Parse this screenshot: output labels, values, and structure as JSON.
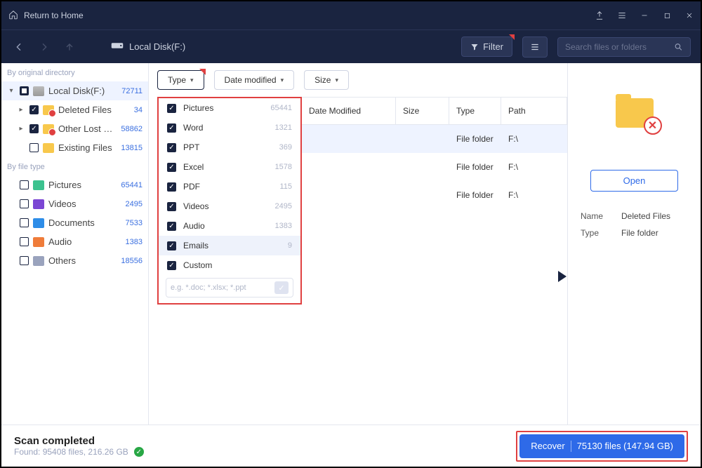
{
  "titlebar": {
    "return": "Return to Home"
  },
  "toolbar": {
    "location": "Local Disk(F:)",
    "filter_label": "Filter",
    "search_placeholder": "Search files or folders"
  },
  "filters": {
    "type": "Type",
    "date": "Date modified",
    "size": "Size"
  },
  "type_panel": {
    "items": [
      {
        "label": "Pictures",
        "count": "65441"
      },
      {
        "label": "Word",
        "count": "1321"
      },
      {
        "label": "PPT",
        "count": "369"
      },
      {
        "label": "Excel",
        "count": "1578"
      },
      {
        "label": "PDF",
        "count": "115"
      },
      {
        "label": "Videos",
        "count": "2495"
      },
      {
        "label": "Audio",
        "count": "1383"
      },
      {
        "label": "Emails",
        "count": "9"
      },
      {
        "label": "Custom",
        "count": ""
      }
    ],
    "input_placeholder": "e.g. *.doc; *.xlsx; *.ppt"
  },
  "sidebar": {
    "head1": "By original directory",
    "head2": "By file type",
    "dir": [
      {
        "label": "Local Disk(F:)",
        "count": "72711",
        "icon": "ic-disk",
        "state": "mixed",
        "arrow": "▾",
        "sel": true
      },
      {
        "label": "Deleted Files",
        "count": "34",
        "icon": "ic-yellow del",
        "state": "checked",
        "arrow": "▸",
        "indent": 1
      },
      {
        "label": "Other Lost Files",
        "count": "58862",
        "icon": "ic-yellow del",
        "state": "checked",
        "arrow": "▸",
        "indent": 1
      },
      {
        "label": "Existing Files",
        "count": "13815",
        "icon": "ic-yellow",
        "state": "",
        "arrow": "",
        "indent": 1
      }
    ],
    "types": [
      {
        "label": "Pictures",
        "count": "65441",
        "icon": "ic-pic"
      },
      {
        "label": "Videos",
        "count": "2495",
        "icon": "ic-vid"
      },
      {
        "label": "Documents",
        "count": "7533",
        "icon": "ic-doc"
      },
      {
        "label": "Audio",
        "count": "1383",
        "icon": "ic-aud"
      },
      {
        "label": "Others",
        "count": "18556",
        "icon": "ic-oth"
      }
    ]
  },
  "table": {
    "headers": {
      "date": "Date Modified",
      "size": "Size",
      "type": "Type",
      "path": "Path"
    },
    "rows": [
      {
        "date": "",
        "size": "",
        "type": "File folder",
        "path": "F:\\",
        "sel": true
      },
      {
        "date": "",
        "size": "",
        "type": "File folder",
        "path": "F:\\"
      },
      {
        "date": "",
        "size": "",
        "type": "File folder",
        "path": "F:\\"
      }
    ]
  },
  "right": {
    "open": "Open",
    "name_k": "Name",
    "name_v": "Deleted Files",
    "type_k": "Type",
    "type_v": "File folder"
  },
  "footer": {
    "title": "Scan completed",
    "sub": "Found: 95408 files, 216.26 GB",
    "recover": "Recover",
    "recover_info": "75130 files (147.94 GB)"
  }
}
